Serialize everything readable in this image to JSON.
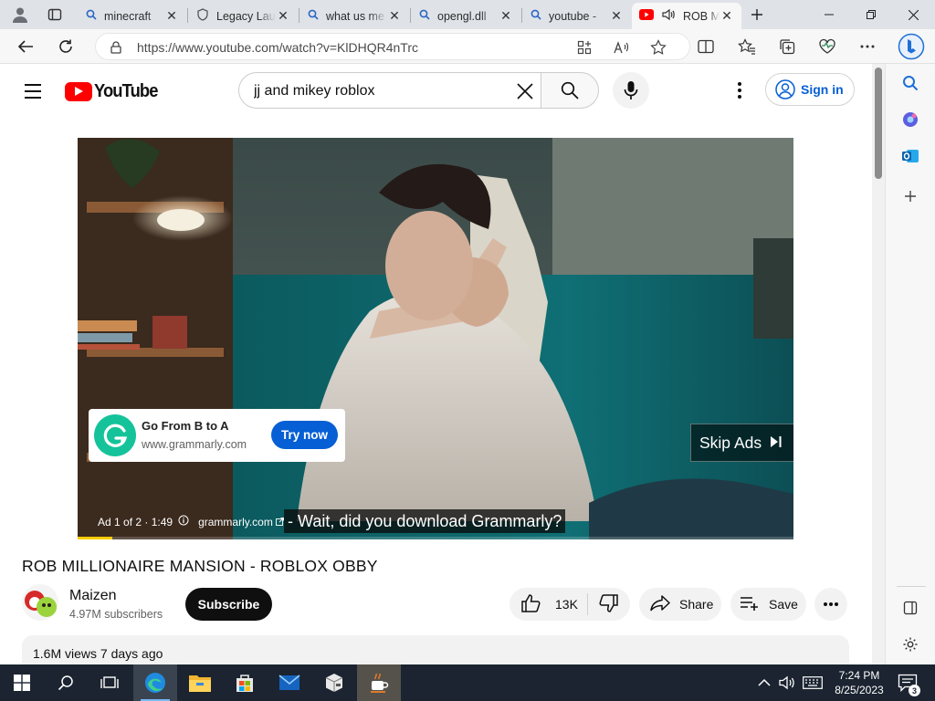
{
  "browser": {
    "tabs": [
      {
        "label": "minecraft",
        "icon": "search-icon"
      },
      {
        "label": "Legacy Launcher",
        "icon": "shield-icon"
      },
      {
        "label": "what us me",
        "icon": "search-icon"
      },
      {
        "label": "opengl.dll",
        "icon": "search-icon"
      },
      {
        "label": "youtube -",
        "icon": "search-icon"
      },
      {
        "label": "ROB MILLIONAIRE MANSION",
        "icon": "youtube-icon",
        "active": true,
        "audio": true
      }
    ],
    "url": "https://www.youtube.com/watch?v=KlDHQR4nTrc"
  },
  "youtube": {
    "logo_text": "YouTube",
    "search_value": "jj and mikey roblox",
    "sign_in": "Sign in",
    "ad": {
      "title": "Go From B to A",
      "url": "www.grammarly.com",
      "cta": "Try now",
      "skip": "Skip Ads",
      "info": "Ad 1 of 2 · 1:49",
      "site": "grammarly.com",
      "progress": 0.048
    },
    "caption": "- Wait, did you download Grammarly?",
    "video_title": "ROB MILLIONAIRE MANSION - ROBLOX OBBY",
    "channel": {
      "name": "Maizen",
      "subscribers": "4.97M subscribers",
      "subscribe": "Subscribe"
    },
    "actions": {
      "likes": "13K",
      "share": "Share",
      "save": "Save"
    },
    "description": {
      "meta": "1.6M views  7 days ago"
    }
  },
  "taskbar": {
    "apps": [
      "start-icon",
      "search-icon",
      "task-view-icon",
      "edge-icon",
      "file-explorer-icon",
      "store-icon",
      "mail-icon",
      "box-icon",
      "java-icon"
    ],
    "time": "7:24 PM",
    "date": "8/25/2023"
  },
  "colors": {
    "youtube_red": "#ff0000",
    "link_blue": "#065fd4",
    "grammarly_green": "#15c39a",
    "ad_progress": "#ffcc00"
  }
}
